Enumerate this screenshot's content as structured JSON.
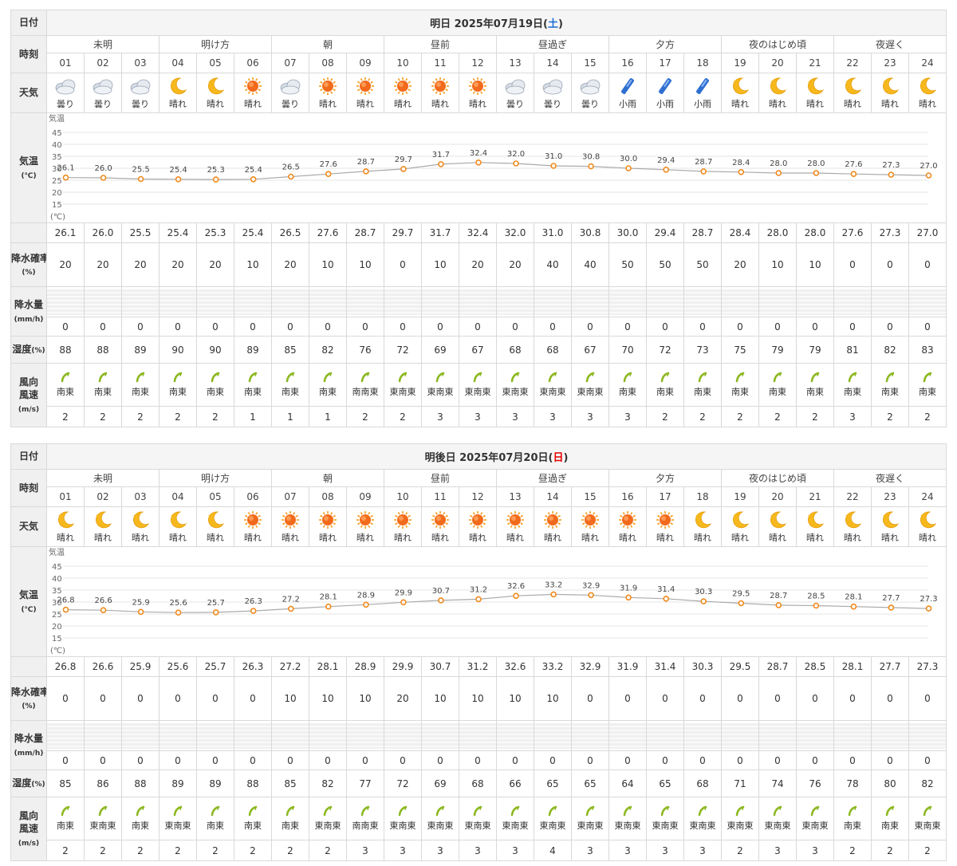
{
  "labels": {
    "date": "日付",
    "time": "時刻",
    "weather": "天気",
    "temp_line1": "気温",
    "temp_line2": "(℃)",
    "precip_prob_line1": "降水確率",
    "precip_prob_line2": "(%)",
    "precip_amt_line1": "降水量",
    "precip_amt_line2": "(mm/h)",
    "humidity": "湿度",
    "humidity_unit": "(%)",
    "wind_line1": "風向",
    "wind_line2": "風速",
    "wind_line3": "(m/s)",
    "chart_top": "気温",
    "chart_bottom": "(℃)"
  },
  "chart_axis": {
    "ticks": [
      "45",
      "40",
      "35",
      "30",
      "25",
      "20",
      "15"
    ],
    "ylim": [
      10,
      50
    ]
  },
  "periods": [
    "未明",
    "明け方",
    "朝",
    "昼前",
    "昼過ぎ",
    "夕方",
    "夜のはじめ頃",
    "夜遅く"
  ],
  "hours": [
    "01",
    "02",
    "03",
    "04",
    "05",
    "06",
    "07",
    "08",
    "09",
    "10",
    "11",
    "12",
    "13",
    "14",
    "15",
    "16",
    "17",
    "18",
    "19",
    "20",
    "21",
    "22",
    "23",
    "24"
  ],
  "colors": {
    "sun_day": "#1a6cd6",
    "holiday": "#e60000",
    "wind_icon": "#8cb821",
    "line": "#aaaaaa",
    "dot": "#f08a1e"
  },
  "days": [
    {
      "title_prefix": "明日 2025年07月19日(",
      "weekday": "土",
      "title_suffix": ")",
      "weekday_style": "sun",
      "weather_icons": [
        "cloudy",
        "cloudy",
        "cloudy",
        "moon",
        "moon",
        "sun",
        "cloudy",
        "sun",
        "sun",
        "sun",
        "sun",
        "sun",
        "cloudy",
        "cloudy",
        "cloudy",
        "rain",
        "rain",
        "rain",
        "moon",
        "moon",
        "moon",
        "moon",
        "moon",
        "moon"
      ],
      "weather": [
        "曇り",
        "曇り",
        "曇り",
        "晴れ",
        "晴れ",
        "晴れ",
        "曇り",
        "晴れ",
        "晴れ",
        "晴れ",
        "晴れ",
        "晴れ",
        "曇り",
        "曇り",
        "曇り",
        "小雨",
        "小雨",
        "小雨",
        "晴れ",
        "晴れ",
        "晴れ",
        "晴れ",
        "晴れ",
        "晴れ"
      ],
      "chart_data": {
        "type": "line",
        "x": [
          "01",
          "02",
          "03",
          "04",
          "05",
          "06",
          "07",
          "08",
          "09",
          "10",
          "11",
          "12",
          "13",
          "14",
          "15",
          "16",
          "17",
          "18",
          "19",
          "20",
          "21",
          "22",
          "23",
          "24"
        ],
        "values": [
          26.1,
          26.0,
          25.5,
          25.4,
          25.3,
          25.4,
          26.5,
          27.6,
          28.7,
          29.7,
          31.7,
          32.4,
          32.0,
          31.0,
          30.8,
          30.0,
          29.4,
          28.7,
          28.4,
          28.0,
          28.0,
          27.6,
          27.3,
          27.0
        ],
        "labels": [
          "26.1",
          "26.0",
          "25.5",
          "25.4",
          "25.3",
          "25.4",
          "26.5",
          "27.6",
          "28.7",
          "29.7",
          "31.7",
          "32.4",
          "32.0",
          "31.0",
          "30.8",
          "30.0",
          "29.4",
          "28.7",
          "28.4",
          "28.0",
          "28.0",
          "27.6",
          "27.3",
          "27.0"
        ],
        "ylim": [
          10,
          50
        ]
      },
      "precip_prob": [
        "20",
        "20",
        "20",
        "20",
        "20",
        "10",
        "20",
        "10",
        "10",
        "0",
        "10",
        "20",
        "20",
        "40",
        "40",
        "50",
        "50",
        "50",
        "20",
        "10",
        "10",
        "0",
        "0",
        "0"
      ],
      "precip_amt": [
        "0",
        "0",
        "0",
        "0",
        "0",
        "0",
        "0",
        "0",
        "0",
        "0",
        "0",
        "0",
        "0",
        "0",
        "0",
        "0",
        "0",
        "0",
        "0",
        "0",
        "0",
        "0",
        "0",
        "0"
      ],
      "humidity": [
        "88",
        "88",
        "89",
        "90",
        "90",
        "89",
        "85",
        "82",
        "76",
        "72",
        "69",
        "67",
        "68",
        "68",
        "67",
        "70",
        "72",
        "73",
        "75",
        "79",
        "79",
        "81",
        "82",
        "83"
      ],
      "wind_dir": [
        "南東",
        "南東",
        "南東",
        "南東",
        "南東",
        "南東",
        "南東",
        "南東",
        "南南東",
        "東南東",
        "東南東",
        "東南東",
        "東南東",
        "東南東",
        "東南東",
        "南東",
        "南東",
        "南東",
        "南東",
        "南東",
        "南東",
        "南東",
        "南東",
        "南東"
      ],
      "wind_speed": [
        "2",
        "2",
        "2",
        "2",
        "2",
        "1",
        "1",
        "1",
        "2",
        "2",
        "3",
        "3",
        "3",
        "3",
        "3",
        "3",
        "2",
        "2",
        "2",
        "2",
        "2",
        "3",
        "2",
        "2"
      ]
    },
    {
      "title_prefix": "明後日 2025年07月20日(",
      "weekday": "日",
      "title_suffix": ")",
      "weekday_style": "hol",
      "weather_icons": [
        "moon",
        "moon",
        "moon",
        "moon",
        "moon",
        "sun",
        "sun",
        "sun",
        "sun",
        "sun",
        "sun",
        "sun",
        "sun",
        "sun",
        "sun",
        "sun",
        "sun",
        "moon",
        "moon",
        "moon",
        "moon",
        "moon",
        "moon",
        "moon"
      ],
      "weather": [
        "晴れ",
        "晴れ",
        "晴れ",
        "晴れ",
        "晴れ",
        "晴れ",
        "晴れ",
        "晴れ",
        "晴れ",
        "晴れ",
        "晴れ",
        "晴れ",
        "晴れ",
        "晴れ",
        "晴れ",
        "晴れ",
        "晴れ",
        "晴れ",
        "晴れ",
        "晴れ",
        "晴れ",
        "晴れ",
        "晴れ",
        "晴れ"
      ],
      "chart_data": {
        "type": "line",
        "x": [
          "01",
          "02",
          "03",
          "04",
          "05",
          "06",
          "07",
          "08",
          "09",
          "10",
          "11",
          "12",
          "13",
          "14",
          "15",
          "16",
          "17",
          "18",
          "19",
          "20",
          "21",
          "22",
          "23",
          "24"
        ],
        "values": [
          26.8,
          26.6,
          25.9,
          25.6,
          25.7,
          26.3,
          27.2,
          28.1,
          28.9,
          29.9,
          30.7,
          31.2,
          32.6,
          33.2,
          32.9,
          31.9,
          31.4,
          30.3,
          29.5,
          28.7,
          28.5,
          28.1,
          27.7,
          27.3
        ],
        "labels": [
          "26.8",
          "26.6",
          "25.9",
          "25.6",
          "25.7",
          "26.3",
          "27.2",
          "28.1",
          "28.9",
          "29.9",
          "30.7",
          "31.2",
          "32.6",
          "33.2",
          "32.9",
          "31.9",
          "31.4",
          "30.3",
          "29.5",
          "28.7",
          "28.5",
          "28.1",
          "27.7",
          "27.3"
        ],
        "ylim": [
          10,
          50
        ]
      },
      "precip_prob": [
        "0",
        "0",
        "0",
        "0",
        "0",
        "0",
        "10",
        "10",
        "10",
        "20",
        "10",
        "10",
        "10",
        "10",
        "0",
        "0",
        "0",
        "0",
        "0",
        "0",
        "0",
        "0",
        "0",
        "0"
      ],
      "precip_amt": [
        "0",
        "0",
        "0",
        "0",
        "0",
        "0",
        "0",
        "0",
        "0",
        "0",
        "0",
        "0",
        "0",
        "0",
        "0",
        "0",
        "0",
        "0",
        "0",
        "0",
        "0",
        "0",
        "0",
        "0"
      ],
      "humidity": [
        "85",
        "86",
        "88",
        "89",
        "89",
        "88",
        "85",
        "82",
        "77",
        "72",
        "69",
        "68",
        "66",
        "65",
        "65",
        "64",
        "65",
        "68",
        "71",
        "74",
        "76",
        "78",
        "80",
        "82"
      ],
      "wind_dir": [
        "南東",
        "東南東",
        "南東",
        "東南東",
        "南東",
        "南東",
        "南東",
        "東南東",
        "南南東",
        "東南東",
        "東南東",
        "東南東",
        "東南東",
        "東南東",
        "東南東",
        "東南東",
        "東南東",
        "東南東",
        "東南東",
        "東南東",
        "東南東",
        "南東",
        "南東",
        "東南東"
      ],
      "wind_speed": [
        "2",
        "2",
        "2",
        "2",
        "2",
        "2",
        "2",
        "2",
        "3",
        "3",
        "3",
        "3",
        "3",
        "4",
        "3",
        "3",
        "3",
        "3",
        "2",
        "3",
        "3",
        "2",
        "2",
        "2"
      ]
    }
  ]
}
